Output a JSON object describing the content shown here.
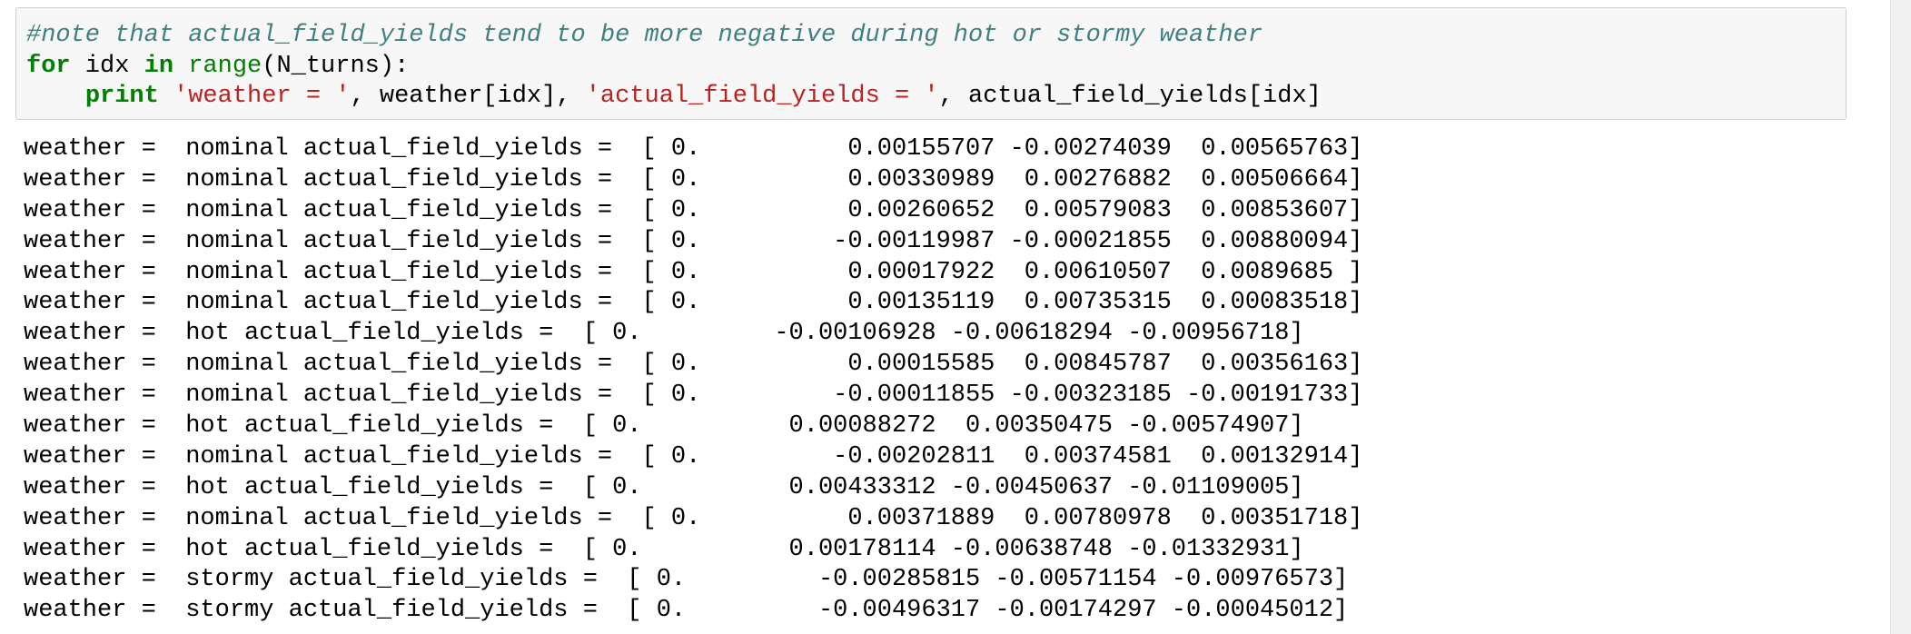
{
  "input": {
    "comment": "#note that actual_field_yields tend to be more negative during hot or stormy weather",
    "line2": {
      "kw_for": "for",
      "sp1": " idx ",
      "kw_in": "in",
      "sp2": " ",
      "builtin_range": "range",
      "rest": "(N_turns):"
    },
    "line3": {
      "indent": "    ",
      "kw_print": "print",
      "sp1": " ",
      "str1": "'weather = '",
      "mid": ", weather[idx], ",
      "str2": "'actual_field_yields = '",
      "end": ", actual_field_yields[idx]"
    }
  },
  "output": {
    "lines": [
      "weather =  nominal actual_field_yields =  [ 0.          0.00155707 -0.00274039  0.00565763]",
      "weather =  nominal actual_field_yields =  [ 0.          0.00330989  0.00276882  0.00506664]",
      "weather =  nominal actual_field_yields =  [ 0.          0.00260652  0.00579083  0.00853607]",
      "weather =  nominal actual_field_yields =  [ 0.         -0.00119987 -0.00021855  0.00880094]",
      "weather =  nominal actual_field_yields =  [ 0.          0.00017922  0.00610507  0.0089685 ]",
      "weather =  nominal actual_field_yields =  [ 0.          0.00135119  0.00735315  0.00083518]",
      "weather =  hot actual_field_yields =  [ 0.         -0.00106928 -0.00618294 -0.00956718]",
      "weather =  nominal actual_field_yields =  [ 0.          0.00015585  0.00845787  0.00356163]",
      "weather =  nominal actual_field_yields =  [ 0.         -0.00011855 -0.00323185 -0.00191733]",
      "weather =  hot actual_field_yields =  [ 0.          0.00088272  0.00350475 -0.00574907]",
      "weather =  nominal actual_field_yields =  [ 0.         -0.00202811  0.00374581  0.00132914]",
      "weather =  hot actual_field_yields =  [ 0.          0.00433312 -0.00450637 -0.01109005]",
      "weather =  nominal actual_field_yields =  [ 0.          0.00371889  0.00780978  0.00351718]",
      "weather =  hot actual_field_yields =  [ 0.          0.00178114 -0.00638748 -0.01332931]",
      "weather =  stormy actual_field_yields =  [ 0.         -0.00285815 -0.00571154 -0.00976573]",
      "weather =  stormy actual_field_yields =  [ 0.         -0.00496317 -0.00174297 -0.00045012]"
    ]
  }
}
